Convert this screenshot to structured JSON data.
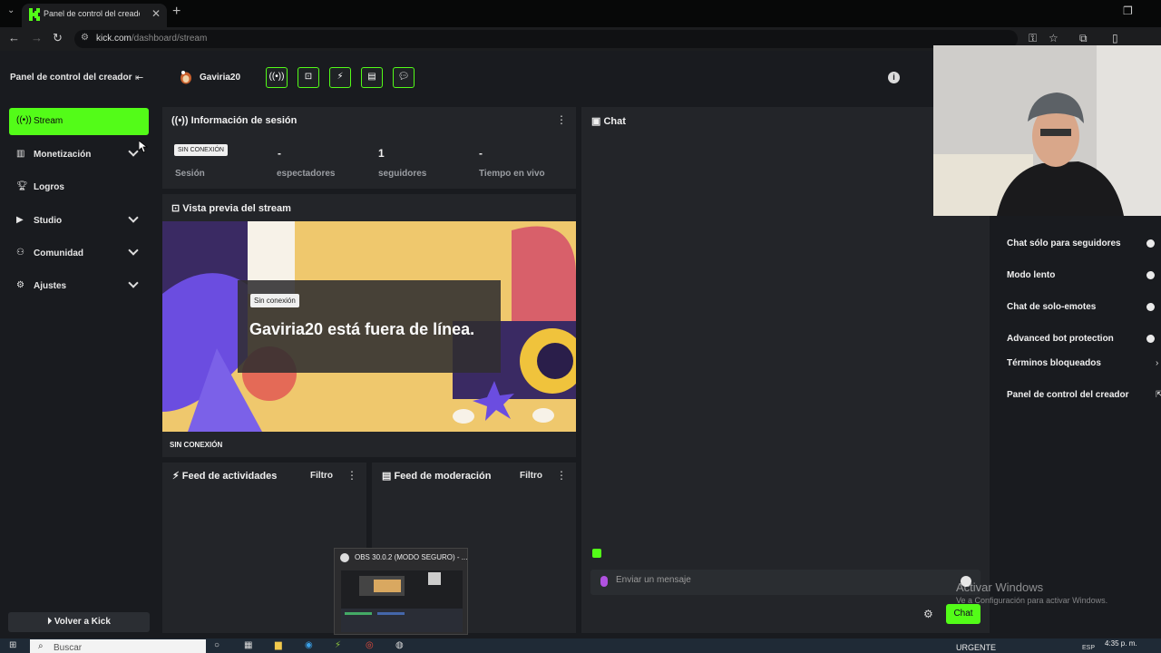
{
  "browser": {
    "tab_title": "Panel de control del creador | K",
    "url_host": "kick.com",
    "url_path": "/dashboard/stream"
  },
  "sidebar": {
    "title": "Panel de control del creador",
    "items": [
      {
        "label": "Stream",
        "icon": "broadcast-icon",
        "active": true
      },
      {
        "label": "Monetización",
        "icon": "chart-icon",
        "expandable": true
      },
      {
        "label": "Logros",
        "icon": "trophy-icon"
      },
      {
        "label": "Studio",
        "icon": "studio-icon",
        "expandable": true
      },
      {
        "label": "Comunidad",
        "icon": "community-icon",
        "expandable": true
      },
      {
        "label": "Ajustes",
        "icon": "gear-icon",
        "expandable": true
      }
    ],
    "back_label": "Volver a Kick"
  },
  "topbar": {
    "username": "Gaviria20"
  },
  "session": {
    "title": "Información de sesión",
    "badge": "SIN CONEXIÓN",
    "stats": [
      {
        "value": "",
        "label": "Sesión"
      },
      {
        "value": "-",
        "label": "espectadores"
      },
      {
        "value": "1",
        "label": "seguidores"
      },
      {
        "value": "-",
        "label": "Tiempo en vivo"
      }
    ]
  },
  "preview": {
    "title": "Vista previa del stream",
    "badge": "Sin conexión",
    "offline_text": "Gaviria20 está fuera de línea.",
    "status": "SIN CONEXIÓN"
  },
  "feed": {
    "title": "Feed de actividades",
    "filter": "Filtro"
  },
  "moderation": {
    "title": "Feed de moderación",
    "filter": "Filtro"
  },
  "chat": {
    "title": "Chat",
    "placeholder": "Enviar un mensaje",
    "send_label": "Chat"
  },
  "chat_settings": {
    "items": [
      {
        "label": "Chat sólo para seguidores",
        "control": "toggle"
      },
      {
        "label": "Modo lento",
        "control": "toggle"
      },
      {
        "label": "Chat de solo-emotes",
        "control": "toggle"
      },
      {
        "label": "Advanced bot protection",
        "control": "toggle"
      },
      {
        "label": "Términos bloqueados",
        "control": "chevron"
      },
      {
        "label": "Panel de control del creador",
        "control": "link"
      }
    ]
  },
  "watermark": {
    "line1": "Activar Windows",
    "line2": "Ve a Configuración para activar Windows."
  },
  "obs": {
    "title": "OBS 30.0.2 (MODO SEGURO) - ..."
  },
  "taskbar": {
    "search": "Buscar",
    "weather": "URGENTE",
    "lang": "ESP",
    "time": "4:35 p. m."
  },
  "colors": {
    "accent": "#53fc18",
    "bg": "#191b1f",
    "panel": "#232529"
  }
}
